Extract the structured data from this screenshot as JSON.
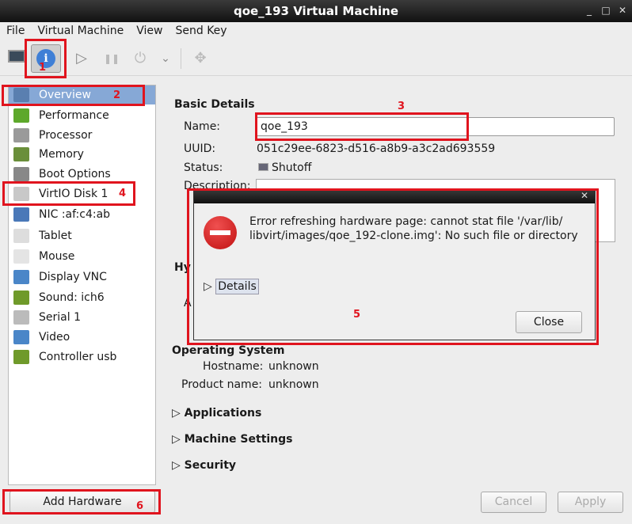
{
  "window": {
    "title": "qoe_193 Virtual Machine",
    "close": "✕",
    "minimize": "_",
    "maximize": "□"
  },
  "menu": [
    "File",
    "Virtual Machine",
    "View",
    "Send Key"
  ],
  "toolbar": {
    "console": "console",
    "details": "i",
    "run": "▷",
    "pause": "❚❚",
    "shutdown": "⏻",
    "dropdown": "⌄",
    "fullscreen": "✥"
  },
  "sidebar": {
    "items": [
      {
        "label": "Overview",
        "color": "#5a7fb0"
      },
      {
        "label": "Performance",
        "color": "#5da82b"
      },
      {
        "label": "Processor",
        "color": "#9a9a9a"
      },
      {
        "label": "Memory",
        "color": "#6a8f3a"
      },
      {
        "label": "Boot Options",
        "color": "#888888"
      },
      {
        "label": "VirtIO Disk 1",
        "color": "#c8c8c8"
      },
      {
        "label": "NIC :af:c4:ab",
        "color": "#4a78b8"
      },
      {
        "label": "Tablet",
        "color": "#dddddd"
      },
      {
        "label": "Mouse",
        "color": "#e4e4e4"
      },
      {
        "label": "Display VNC",
        "color": "#4a86c8"
      },
      {
        "label": "Sound: ich6",
        "color": "#6f9a2a"
      },
      {
        "label": "Serial 1",
        "color": "#bbbbbb"
      },
      {
        "label": "Video",
        "color": "#4a86c8"
      },
      {
        "label": "Controller usb",
        "color": "#6f9a2a"
      }
    ],
    "add_hardware": "Add Hardware"
  },
  "details": {
    "basic_heading": "Basic Details",
    "name_label": "Name:",
    "name_value": "qoe_193",
    "uuid_label": "UUID:",
    "uuid_value": "051c29ee-6823-d516-a8b9-a3c2ad693559",
    "status_label": "Status:",
    "status_value": "Shutoff",
    "description_label": "Description:",
    "hypervisor_partial": "Hy",
    "arch_partial": "A",
    "os_heading": "Operating System",
    "hostname_label": "Hostname:",
    "hostname_value": "unknown",
    "product_label": "Product name:",
    "product_value": "unknown",
    "sections": [
      "Applications",
      "Machine Settings",
      "Security"
    ]
  },
  "buttons": {
    "cancel": "Cancel",
    "apply": "Apply"
  },
  "dialog": {
    "close_x": "✕",
    "message": "Error refreshing hardware page: cannot stat file '/var/lib/ libvirt/images/qoe_192-clone.img': No such file or directory",
    "details": "Details",
    "close": "Close"
  },
  "annotations": [
    "1",
    "2",
    "3",
    "4",
    "5",
    "6"
  ],
  "colors": {
    "annotation": "#e0141e",
    "selection": "#86a8d6",
    "error": "#d42020"
  }
}
